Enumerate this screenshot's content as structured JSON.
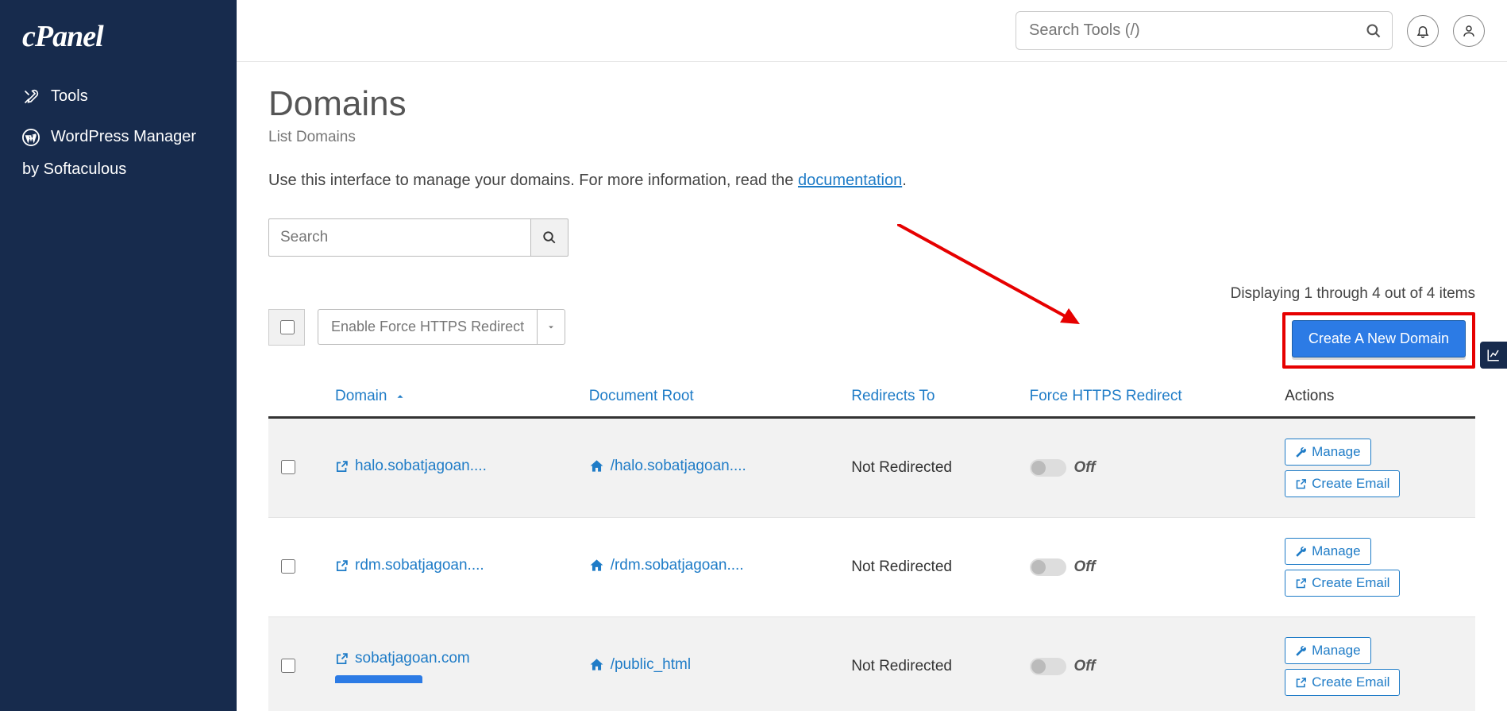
{
  "brand": "cPanel",
  "sidebar": {
    "items": [
      {
        "label": "Tools"
      },
      {
        "label": "WordPress Manager"
      }
    ],
    "subline": "by Softaculous"
  },
  "topbar": {
    "search_placeholder": "Search Tools (/)"
  },
  "page": {
    "title": "Domains",
    "subtitle": "List Domains",
    "intro_pre": "Use this interface to manage your domains. For more information, read the ",
    "intro_link": "documentation",
    "intro_post": ".",
    "search_placeholder": "Search",
    "bulk_button": "Enable Force HTTPS Redirect",
    "display_text": "Displaying 1 through 4 out of 4 items",
    "create_button": "Create A New Domain"
  },
  "table": {
    "headers": {
      "domain": "Domain",
      "docroot": "Document Root",
      "redirects": "Redirects To",
      "https": "Force HTTPS Redirect",
      "actions": "Actions"
    },
    "toggle_off": "Off",
    "manage": "Manage",
    "create_email": "Create Email",
    "rows": [
      {
        "domain": "halo.sobatjagoan....",
        "docroot": "/halo.sobatjagoan....",
        "redirects": "Not Redirected",
        "show_main": false
      },
      {
        "domain": "rdm.sobatjagoan....",
        "docroot": "/rdm.sobatjagoan....",
        "redirects": "Not Redirected",
        "show_main": false
      },
      {
        "domain": "sobatjagoan.com",
        "docroot": "/public_html",
        "redirects": "Not Redirected",
        "show_main": true
      }
    ]
  }
}
